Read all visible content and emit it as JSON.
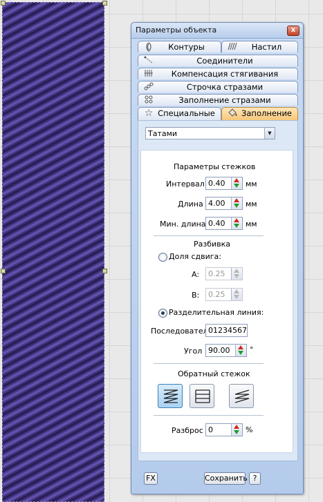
{
  "dialog": {
    "title": "Параметры объекта",
    "close_label": "x"
  },
  "tabs": [
    {
      "label": "Контуры",
      "icon": "outline-icon"
    },
    {
      "label": "Настил",
      "icon": "satin-icon"
    },
    {
      "label": "Соединители",
      "icon": "connector-icon"
    },
    {
      "label": "Компенсация стягивания",
      "icon": "pull-compensation-icon"
    },
    {
      "label": "Строчка стразами",
      "icon": "rhinestone-run-icon"
    },
    {
      "label": "Заполнение стразами",
      "icon": "rhinestone-fill-icon"
    },
    {
      "label": "Специальные",
      "icon": "star-icon"
    },
    {
      "label": "Заполнение",
      "icon": "fill-bucket-icon",
      "active": true
    }
  ],
  "fill_type": {
    "selected": "Татами"
  },
  "stitch_params": {
    "heading": "Параметры стежков",
    "interval": {
      "label": "Интервал",
      "value": "0.40",
      "unit": "мм"
    },
    "length": {
      "label": "Длина",
      "value": "4.00",
      "unit": "мм"
    },
    "min_length": {
      "label": "Мин. длина",
      "value": "0.40",
      "unit": "мм"
    }
  },
  "partition": {
    "heading": "Разбивка",
    "offset_fraction": {
      "label": "Доля сдвига:",
      "selected": false
    },
    "a": {
      "label": "A:",
      "value": "0.25"
    },
    "b": {
      "label": "B:",
      "value": "0.25"
    },
    "dividing_line": {
      "label": "Разделительная линия:",
      "selected": true
    },
    "sequence": {
      "label": "Последовател",
      "value": "01234567"
    },
    "angle": {
      "label": "Угол",
      "value": "90.00",
      "unit": "°"
    }
  },
  "reverse_stitch": {
    "heading": "Обратный стежок"
  },
  "scatter": {
    "label": "Разброс",
    "value": "0",
    "unit": "%"
  },
  "footer": {
    "fx_label": "FX",
    "save_label": "Сохранить",
    "help_label": "?"
  },
  "colors": {
    "thread": "#3d2f74",
    "active_tab": "#f7c77b",
    "dialog_bg": "#c9dbf3"
  }
}
